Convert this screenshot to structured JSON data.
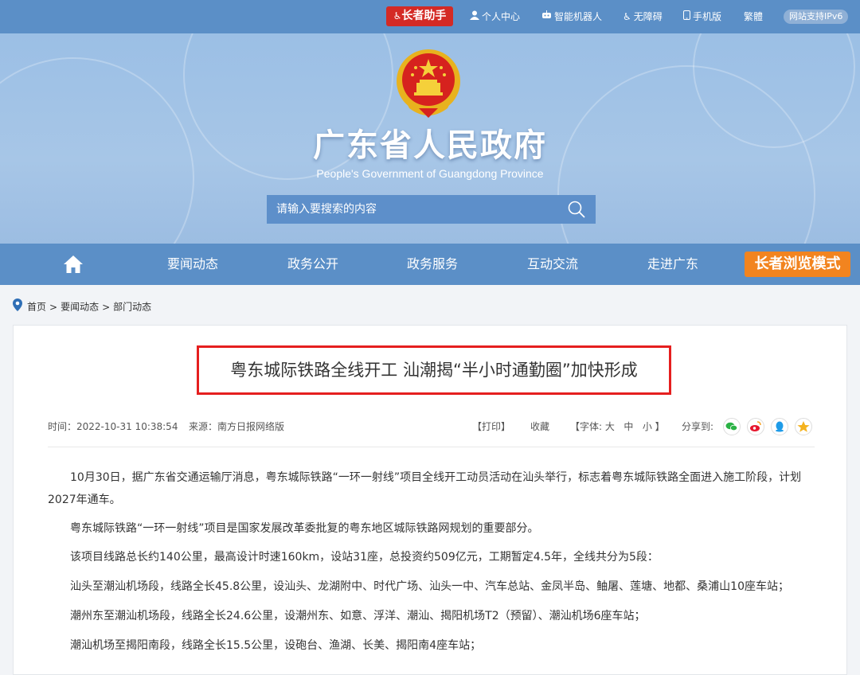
{
  "topbar": {
    "elder_helper": "长者助手",
    "personal_center": "个人中心",
    "robot": "智能机器人",
    "accessibility": "无障碍",
    "mobile": "手机版",
    "traditional": "繁體",
    "ipv6": "网站支持IPv6"
  },
  "banner": {
    "title": "广东省人民政府",
    "subtitle": "People's Government of Guangdong Province",
    "search_placeholder": "请输入要搜索的内容"
  },
  "nav": {
    "items": [
      "要闻动态",
      "政务公开",
      "政务服务",
      "互动交流",
      "走进广东"
    ],
    "elder_mode": "长者浏览模式"
  },
  "breadcrumb": [
    "首页",
    "要闻动态",
    "部门动态"
  ],
  "article": {
    "title": "粤东城际铁路全线开工 汕潮揭“半小时通勤圈”加快形成",
    "time": "时间：2022-10-31 10:38:54",
    "source": "来源：南方日报网络版",
    "print": "【打印】",
    "favorite": "收藏",
    "font_prefix": "【字体:",
    "font_large": "大",
    "font_medium": "中",
    "font_small": "小",
    "font_suffix": "】",
    "share_label": "分享到:",
    "paragraphs": [
      "10月30日，据广东省交通运输厅消息，粤东城际铁路“一环一射线”项目全线开工动员活动在汕头举行，标志着粤东城际铁路全面进入施工阶段，计划2027年通车。",
      "粤东城际铁路“一环一射线”项目是国家发展改革委批复的粤东地区城际铁路网规划的重要部分。",
      "该项目线路总长约140公里，最高设计时速160km，设站31座，总投资约509亿元，工期暂定4.5年，全线共分为5段：",
      "汕头至潮汕机场段，线路全长45.8公里，设汕头、龙湖附中、时代广场、汕头一中、汽车总站、金凤半岛、鲉屠、莲塘、地都、桑浦山10座车站；",
      "潮州东至潮汕机场段，线路全长24.6公里，设潮州东、如意、浮洋、潮汕、揭阳机场T2（预留）、潮汕机场6座车站；",
      "潮汕机场至揭阳南段，线路全长15.5公里，设砲台、渔湖、长美、揭阳南4座车站；"
    ]
  },
  "colors": {
    "bar_blue": "#5b8fc7",
    "elder_red": "#d42a25",
    "elder_orange": "#f2841f",
    "highlight_red": "#e51f1f"
  }
}
